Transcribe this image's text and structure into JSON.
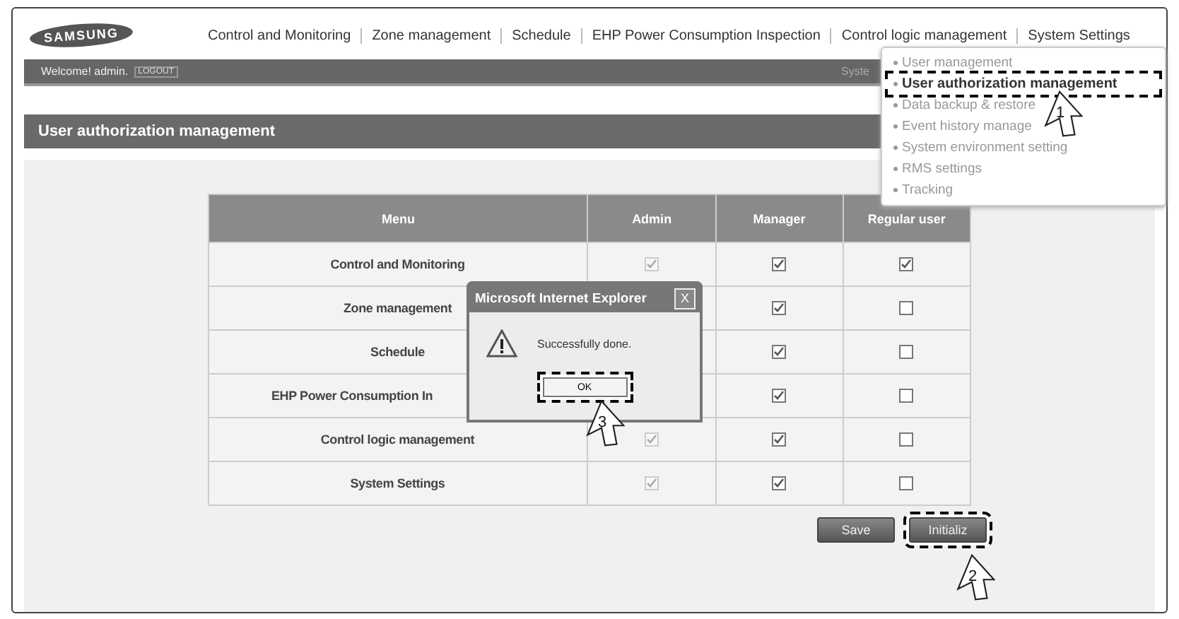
{
  "header": {
    "logo": "SAMSUNG",
    "nav": [
      {
        "label": "Control and Monitoring"
      },
      {
        "label": "Zone management"
      },
      {
        "label": "Schedule"
      },
      {
        "label": "EHP Power Consumption Inspection"
      },
      {
        "label": "Control logic management"
      },
      {
        "label": "System Settings"
      }
    ]
  },
  "welcome_bar": {
    "greeting": "Welcome! admin.",
    "logout": "LOGOUT",
    "right_text": "Syste"
  },
  "page_title": "User authorization management",
  "table": {
    "columns": [
      "Menu",
      "Admin",
      "Manager",
      "Regular user"
    ],
    "rows": [
      {
        "kind": "full",
        "menu": "Control and Monitoring",
        "admin": {
          "checked": true,
          "disabled": true
        },
        "manager": {
          "checked": true,
          "disabled": false
        },
        "regular": {
          "checked": true,
          "disabled": false
        }
      },
      {
        "kind": "full",
        "menu": "Zone management",
        "manager": {
          "checked": true,
          "disabled": false
        },
        "regular": {
          "checked": false,
          "disabled": false
        }
      },
      {
        "kind": "full",
        "menu": "Schedule",
        "manager": {
          "checked": true,
          "disabled": false
        },
        "regular": {
          "checked": false,
          "disabled": false
        }
      },
      {
        "kind": "clipped",
        "menu": "EHP Power Consumption In",
        "manager": {
          "checked": true,
          "disabled": false
        },
        "regular": {
          "checked": false,
          "disabled": false
        }
      },
      {
        "kind": "full",
        "menu": "Control logic management",
        "admin": {
          "checked": true,
          "disabled": true
        },
        "manager": {
          "checked": true,
          "disabled": false
        },
        "regular": {
          "checked": false,
          "disabled": false
        }
      },
      {
        "kind": "full",
        "menu": "System Settings",
        "admin": {
          "checked": true,
          "disabled": true
        },
        "manager": {
          "checked": true,
          "disabled": false
        },
        "regular": {
          "checked": false,
          "disabled": false
        }
      }
    ]
  },
  "buttons": [
    {
      "label": "Save",
      "highlighted": false
    },
    {
      "label": "Initializ",
      "highlighted": true
    }
  ],
  "dropdown": {
    "items": [
      {
        "label": "User management",
        "selected": false
      },
      {
        "label": "User authorization management",
        "selected": true
      },
      {
        "label": "Data backup & restore",
        "selected": false
      },
      {
        "label": "Event history manage",
        "selected": false
      },
      {
        "label": "System environment setting",
        "selected": false
      },
      {
        "label": "RMS settings",
        "selected": false
      },
      {
        "label": "Tracking",
        "selected": false
      }
    ]
  },
  "dialog": {
    "title": "Microsoft Internet Explorer",
    "close": "X",
    "message": "Successfully done.",
    "ok": {
      "label": "OK",
      "highlighted": true
    }
  },
  "callouts": [
    {
      "number": "1"
    },
    {
      "number": "2"
    },
    {
      "number": "3"
    }
  ]
}
